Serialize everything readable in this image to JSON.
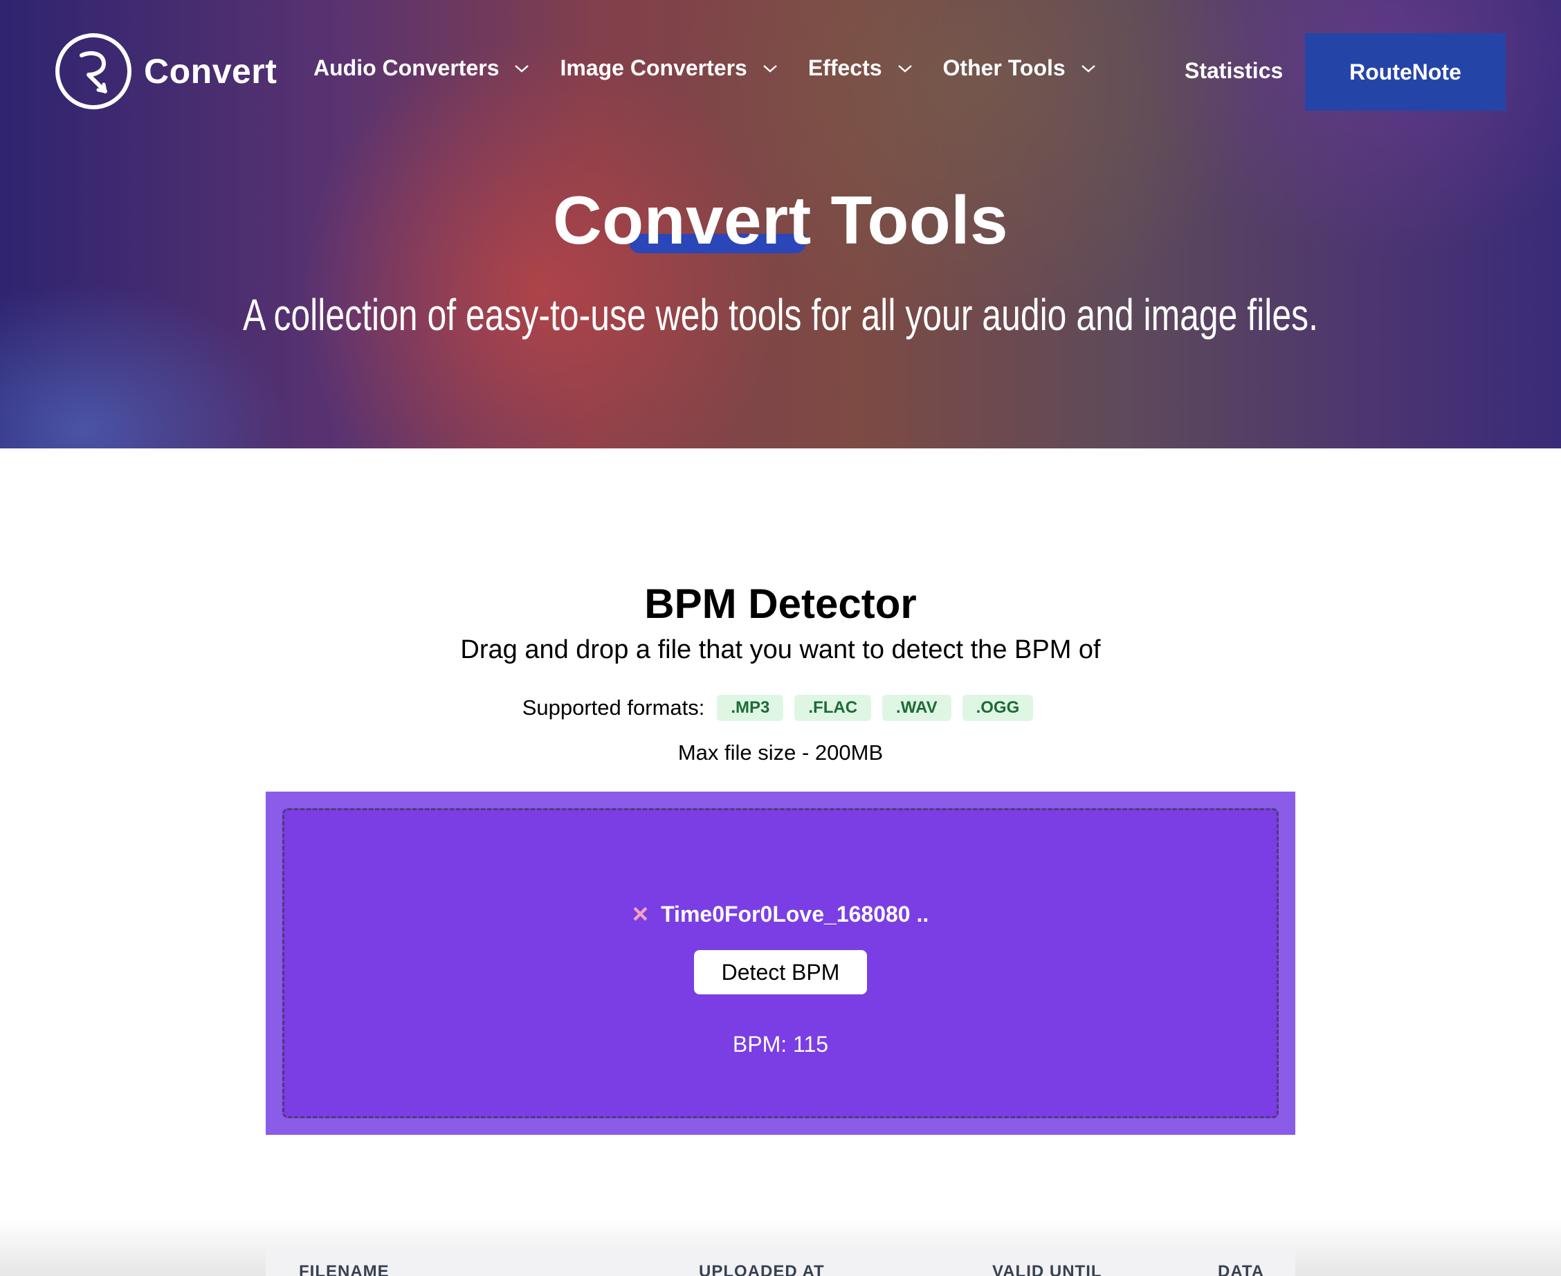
{
  "header": {
    "logo_text": "Convert",
    "nav": [
      {
        "label": "Audio Converters"
      },
      {
        "label": "Image Converters"
      },
      {
        "label": "Effects"
      },
      {
        "label": "Other Tools"
      }
    ],
    "statistics_label": "Statistics",
    "routenote_label": "RouteNote"
  },
  "hero": {
    "title": "Convert Tools",
    "subtitle": "A collection of easy-to-use web tools for all your audio and image files."
  },
  "tool": {
    "title": "BPM Detector",
    "description": "Drag and drop a file that you want to detect the BPM of",
    "formats_label": "Supported formats:",
    "formats": [
      ".MP3",
      ".FLAC",
      ".WAV",
      ".OGG"
    ],
    "max_size": "Max file size - 200MB",
    "file_name": "Time0For0Love_168080 ..",
    "remove_icon": "×",
    "detect_label": "Detect BPM",
    "result": "BPM: 115"
  },
  "table": {
    "headers": [
      "FILENAME",
      "UPLOADED AT",
      "VALID UNTIL",
      "DATA"
    ]
  },
  "colors": {
    "routenote_button": "#2544a8",
    "drop_zone": "#7a3ee4",
    "format_badge_bg": "#dff6e5",
    "format_badge_text": "#1d6b34"
  }
}
